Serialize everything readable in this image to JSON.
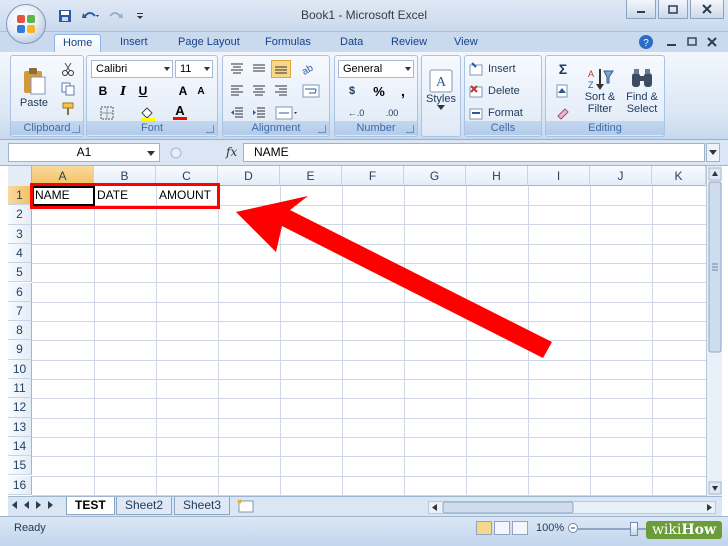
{
  "window": {
    "title": "Book1 - Microsoft Excel"
  },
  "tabs": [
    {
      "label": "Home"
    },
    {
      "label": "Insert"
    },
    {
      "label": "Page Layout"
    },
    {
      "label": "Formulas"
    },
    {
      "label": "Data"
    },
    {
      "label": "Review"
    },
    {
      "label": "View"
    }
  ],
  "ribbon": {
    "clipboard": {
      "label": "Clipboard",
      "paste": "Paste"
    },
    "font": {
      "label": "Font",
      "name": "Calibri",
      "size": "11",
      "bold": "B",
      "italic": "I",
      "underline": "U",
      "grow": "A",
      "shrink": "A",
      "color_a": "A"
    },
    "alignment": {
      "label": "Alignment"
    },
    "number": {
      "label": "Number",
      "format": "General",
      "currency": "$",
      "percent": "%",
      "comma": ",",
      "inc_dec": "←.0",
      "dec_dec": ".00"
    },
    "styles": {
      "label": "Styles"
    },
    "cells": {
      "label": "Cells",
      "insert": "Insert",
      "delete": "Delete",
      "format": "Format"
    },
    "editing": {
      "label": "Editing",
      "sum": "Σ",
      "sort": "Sort &",
      "filter": "Filter",
      "find": "Find &",
      "select": "Select"
    }
  },
  "formula_bar": {
    "name_box": "A1",
    "fx": "fx",
    "content": "NAME"
  },
  "grid": {
    "columns": [
      "A",
      "B",
      "C",
      "D",
      "E",
      "F",
      "G",
      "H",
      "I",
      "J",
      "K"
    ],
    "rows": [
      "1",
      "2",
      "3",
      "4",
      "5",
      "6",
      "7",
      "8",
      "9",
      "10",
      "11",
      "12",
      "13",
      "14",
      "15",
      "16"
    ],
    "cells": {
      "A1": "NAME",
      "B1": "DATE",
      "C1": "AMOUNT"
    }
  },
  "sheets": [
    {
      "label": "TEST"
    },
    {
      "label": "Sheet2"
    },
    {
      "label": "Sheet3"
    }
  ],
  "status": {
    "text": "Ready",
    "zoom": "100%"
  },
  "watermark": {
    "left": "wiki",
    "right": "How"
  },
  "colors": {
    "highlight_box": "#ff0000",
    "arrow": "#ff0000",
    "selected_header": "#f1c15f"
  }
}
